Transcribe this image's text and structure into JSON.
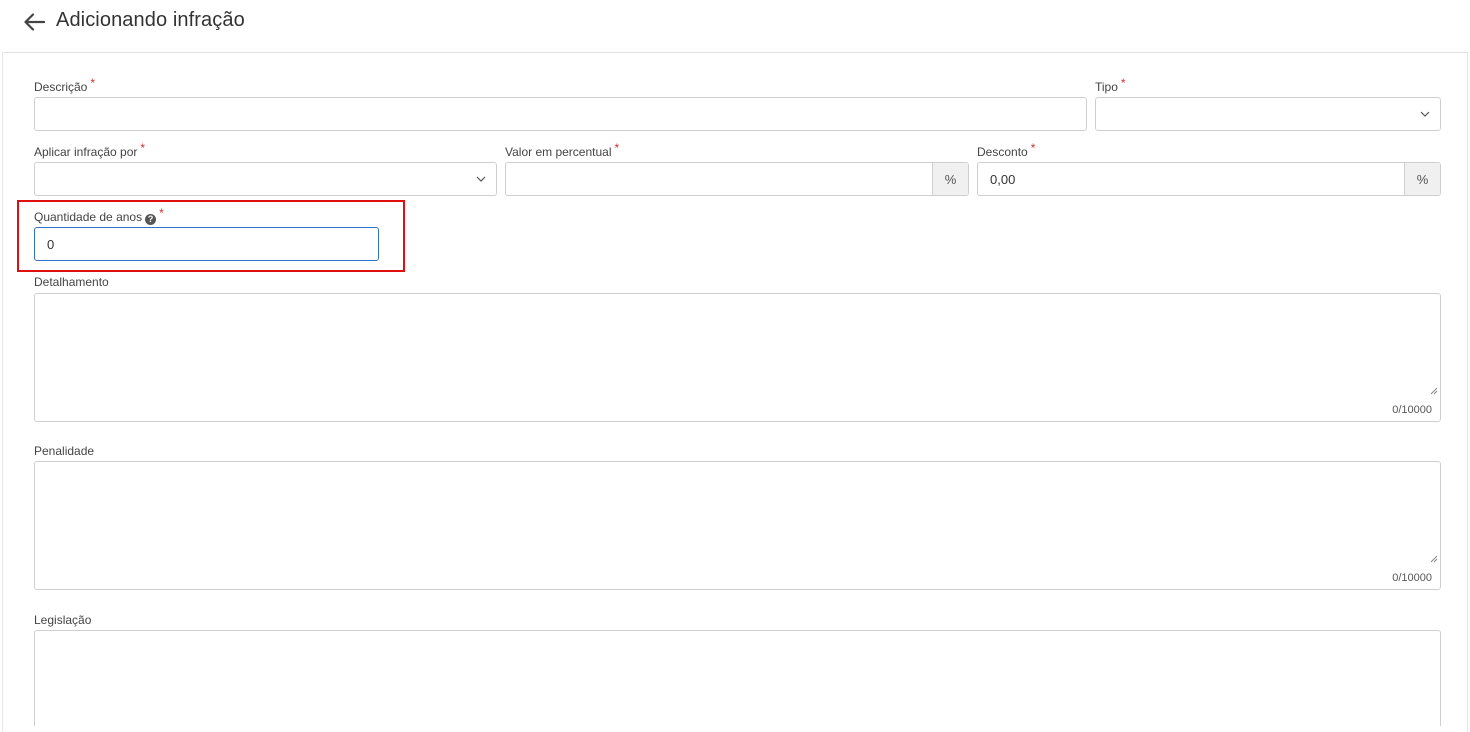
{
  "header": {
    "title": "Adicionando infração",
    "back_icon": "arrow-left-icon"
  },
  "form": {
    "required_mark": "*",
    "descricao": {
      "label": "Descrição",
      "value": ""
    },
    "tipo": {
      "label": "Tipo",
      "value": ""
    },
    "aplicar_infracao_por": {
      "label": "Aplicar infração por",
      "value": ""
    },
    "valor_em_percentual": {
      "label": "Valor em percentual",
      "value": "",
      "addon": "%"
    },
    "desconto": {
      "label": "Desconto",
      "value": "0,00",
      "addon": "%"
    },
    "quantidade_de_anos": {
      "label": "Quantidade de anos",
      "value": "0",
      "help_icon": "?"
    },
    "detalhamento": {
      "label": "Detalhamento",
      "counter": "0/10000"
    },
    "penalidade": {
      "label": "Penalidade",
      "counter": "0/10000"
    },
    "legislacao": {
      "label": "Legislação"
    }
  },
  "colors": {
    "required": "#d32f2f",
    "focus_border": "#2f6fc4",
    "highlight_border": "#e01010"
  }
}
